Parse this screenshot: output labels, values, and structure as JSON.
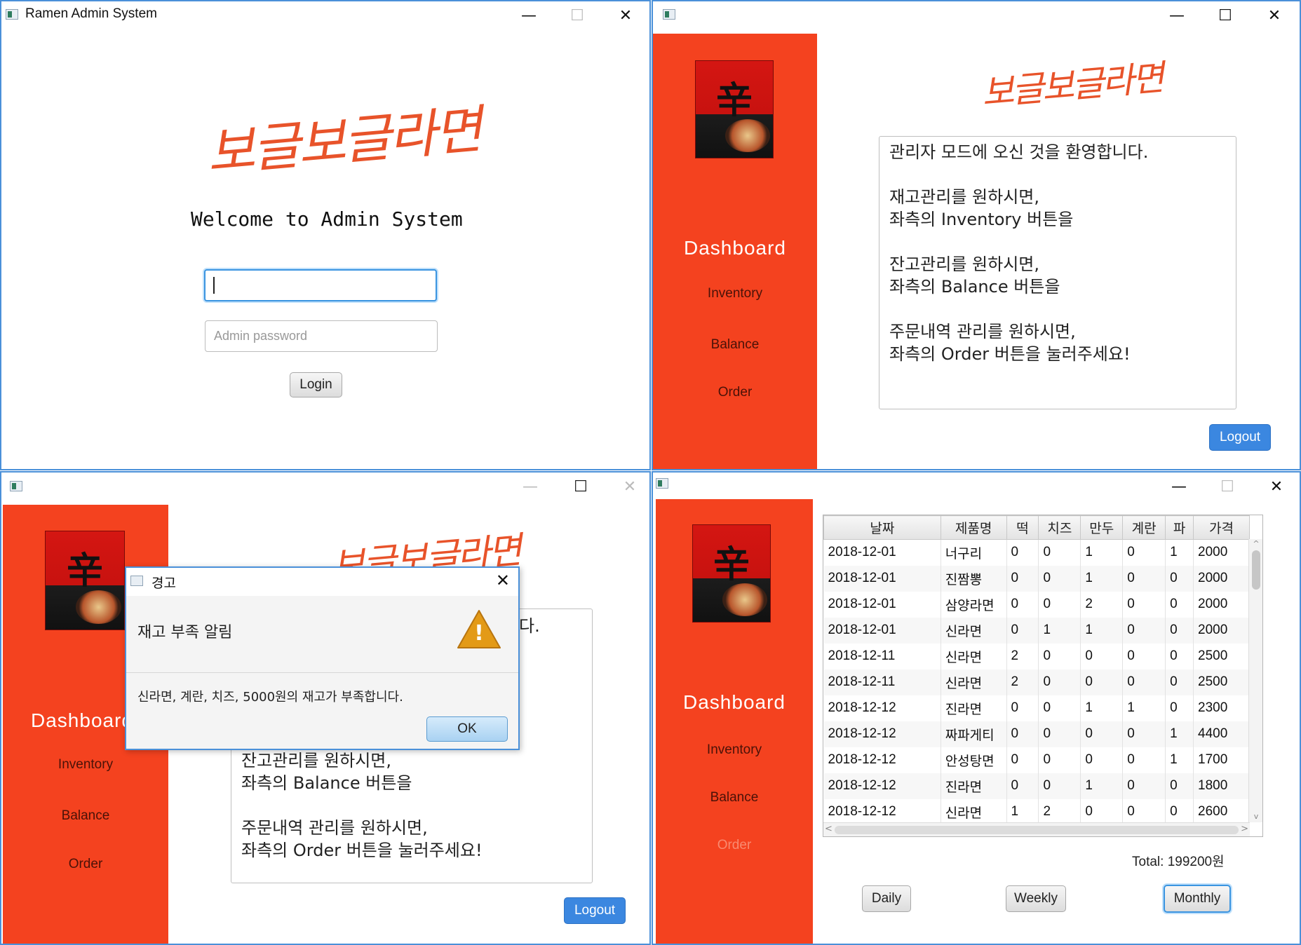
{
  "login_window": {
    "title": "Ramen Admin System",
    "logo_text": "보글보글라면",
    "welcome": "Welcome to Admin System",
    "username_value": "",
    "password_placeholder": "Admin password",
    "login_label": "Login"
  },
  "dashboard_window": {
    "logo_text": "보글보글라면",
    "sidebar": {
      "header": "Dashboard",
      "items": [
        "Inventory",
        "Balance",
        "Order"
      ]
    },
    "message": "관리자 모드에 오신 것을 환영합니다.\n\n재고관리를 원하시면,\n좌측의 Inventory 버튼을\n\n잔고관리를 원하시면,\n좌측의 Balance 버튼을\n\n주문내역 관리를 원하시면,\n좌측의 Order 버튼을 눌러주세요!",
    "logout_label": "Logout"
  },
  "alert_window": {
    "logo_text": "보글보글라면",
    "sidebar": {
      "header": "Dashboard",
      "items": [
        "Inventory",
        "Balance",
        "Order"
      ]
    },
    "message_partial": "잔고관리를 원하시면,\n좌측의 Balance 버튼을\n\n주문내역 관리를 원하시면,\n좌측의 Order 버튼을 눌러주세요!",
    "message_fragment": "다.",
    "logout_label": "Logout",
    "dialog": {
      "title": "경고",
      "header": "재고 부족 알림",
      "content": "신라면, 계란, 치즈, 5000원의 재고가 부족합니다.",
      "ok_label": "OK",
      "warning_icon_glyph": "!"
    }
  },
  "order_window": {
    "sidebar": {
      "header": "Dashboard",
      "items": [
        "Inventory",
        "Balance",
        "Order"
      ]
    },
    "table": {
      "columns": [
        "날짜",
        "제품명",
        "떡",
        "치즈",
        "만두",
        "계란",
        "파",
        "가격"
      ],
      "rows": [
        [
          "2018-12-01",
          "너구리",
          "0",
          "0",
          "1",
          "0",
          "1",
          "2000"
        ],
        [
          "2018-12-01",
          "진짬뽕",
          "0",
          "0",
          "1",
          "0",
          "0",
          "2000"
        ],
        [
          "2018-12-01",
          "삼양라면",
          "0",
          "0",
          "2",
          "0",
          "0",
          "2000"
        ],
        [
          "2018-12-01",
          "신라면",
          "0",
          "1",
          "1",
          "0",
          "0",
          "2000"
        ],
        [
          "2018-12-11",
          "신라면",
          "2",
          "0",
          "0",
          "0",
          "0",
          "2500"
        ],
        [
          "2018-12-11",
          "신라면",
          "2",
          "0",
          "0",
          "0",
          "0",
          "2500"
        ],
        [
          "2018-12-12",
          "진라면",
          "0",
          "0",
          "1",
          "1",
          "0",
          "2300"
        ],
        [
          "2018-12-12",
          "짜파게티",
          "0",
          "0",
          "0",
          "0",
          "1",
          "4400"
        ],
        [
          "2018-12-12",
          "안성탕면",
          "0",
          "0",
          "0",
          "0",
          "1",
          "1700"
        ],
        [
          "2018-12-12",
          "진라면",
          "0",
          "0",
          "1",
          "0",
          "0",
          "1800"
        ],
        [
          "2018-12-12",
          "신라면",
          "1",
          "2",
          "0",
          "0",
          "0",
          "2600"
        ]
      ]
    },
    "total": "Total: 199200원",
    "buttons": [
      "Daily",
      "Weekly",
      "Monthly"
    ]
  },
  "window_controls": {
    "minimize": "—",
    "maximize": "☐",
    "close": "✕"
  },
  "package_glyph": "辛",
  "colors": {
    "sidebar": "#f4421f",
    "accent": "#3b87e0",
    "window_border": "#4a90d9"
  }
}
